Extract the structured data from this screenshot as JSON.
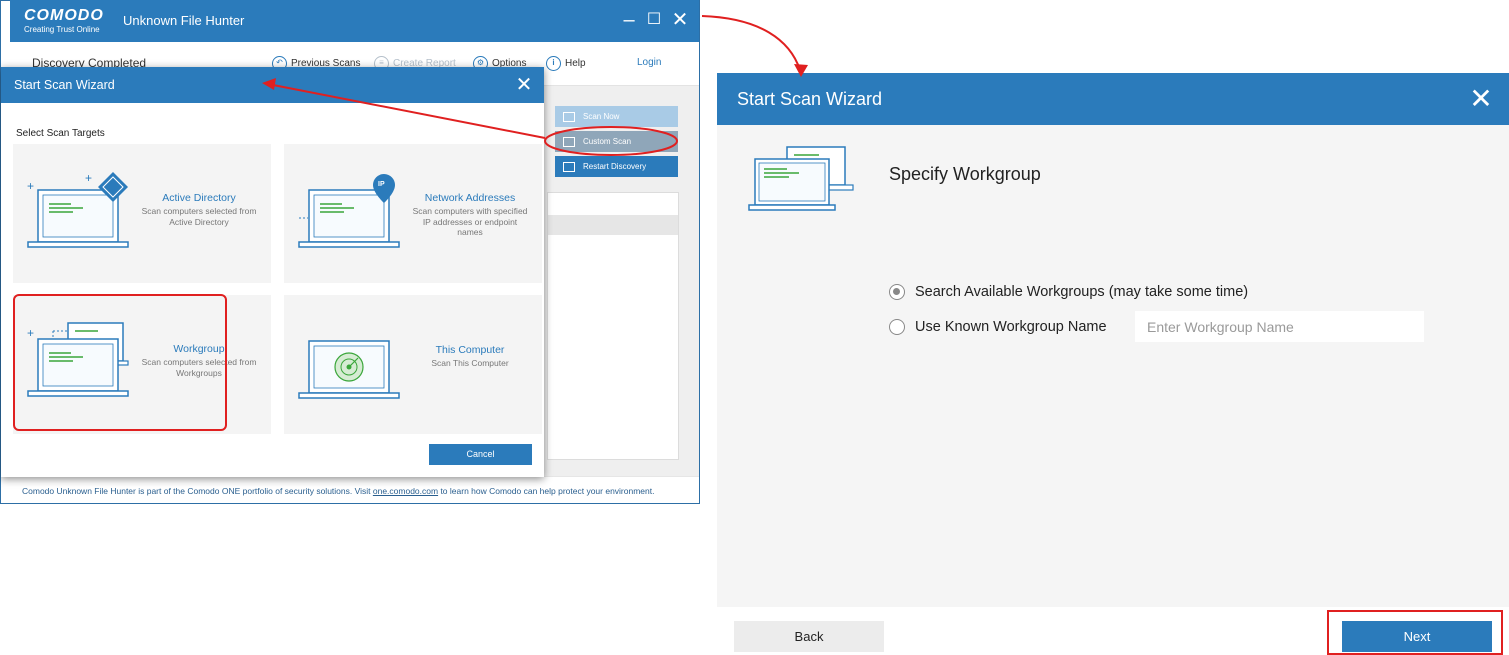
{
  "app": {
    "logo_name": "COMODO",
    "logo_tagline": "Creating Trust Online",
    "title": "Unknown File Hunter",
    "status": "Discovery Completed",
    "toolbar": {
      "previous_scans": "Previous Scans",
      "create_report": "Create Report",
      "options": "Options",
      "help": "Help",
      "login": "Login"
    },
    "side_buttons": {
      "scan_now": "Scan Now",
      "custom_scan": "Custom Scan",
      "restart_discovery": "Restart Discovery"
    },
    "footer_pre": "Comodo Unknown File Hunter is part of the Comodo ONE portfolio of security solutions. Visit ",
    "footer_link": "one.comodo.com",
    "footer_post": " to learn how Comodo can help protect your environment."
  },
  "wizard_small": {
    "title": "Start Scan Wizard",
    "subtitle": "Select Scan Targets",
    "tiles": [
      {
        "title": "Active Directory",
        "desc": "Scan computers selected from Active Directory"
      },
      {
        "title": "Network Addresses",
        "desc": "Scan computers with specified IP addresses or endpoint names"
      },
      {
        "title": "Workgroup",
        "desc": "Scan computers selected from Workgroups"
      },
      {
        "title": "This Computer",
        "desc": "Scan This Computer"
      }
    ],
    "ip_badge": "IP",
    "cancel": "Cancel"
  },
  "wizard_big": {
    "title": "Start Scan Wizard",
    "step_title": "Specify Workgroup",
    "option_search": "Search Available Workgroups (may take some time)",
    "option_known": "Use Known Workgroup Name",
    "input_placeholder": "Enter Workgroup Name",
    "input_value": "",
    "selected_option": "search",
    "back": "Back",
    "next": "Next"
  },
  "colors": {
    "accent": "#2b7bbb",
    "annotation": "#e02020",
    "screen_line": "#3aa63a"
  }
}
